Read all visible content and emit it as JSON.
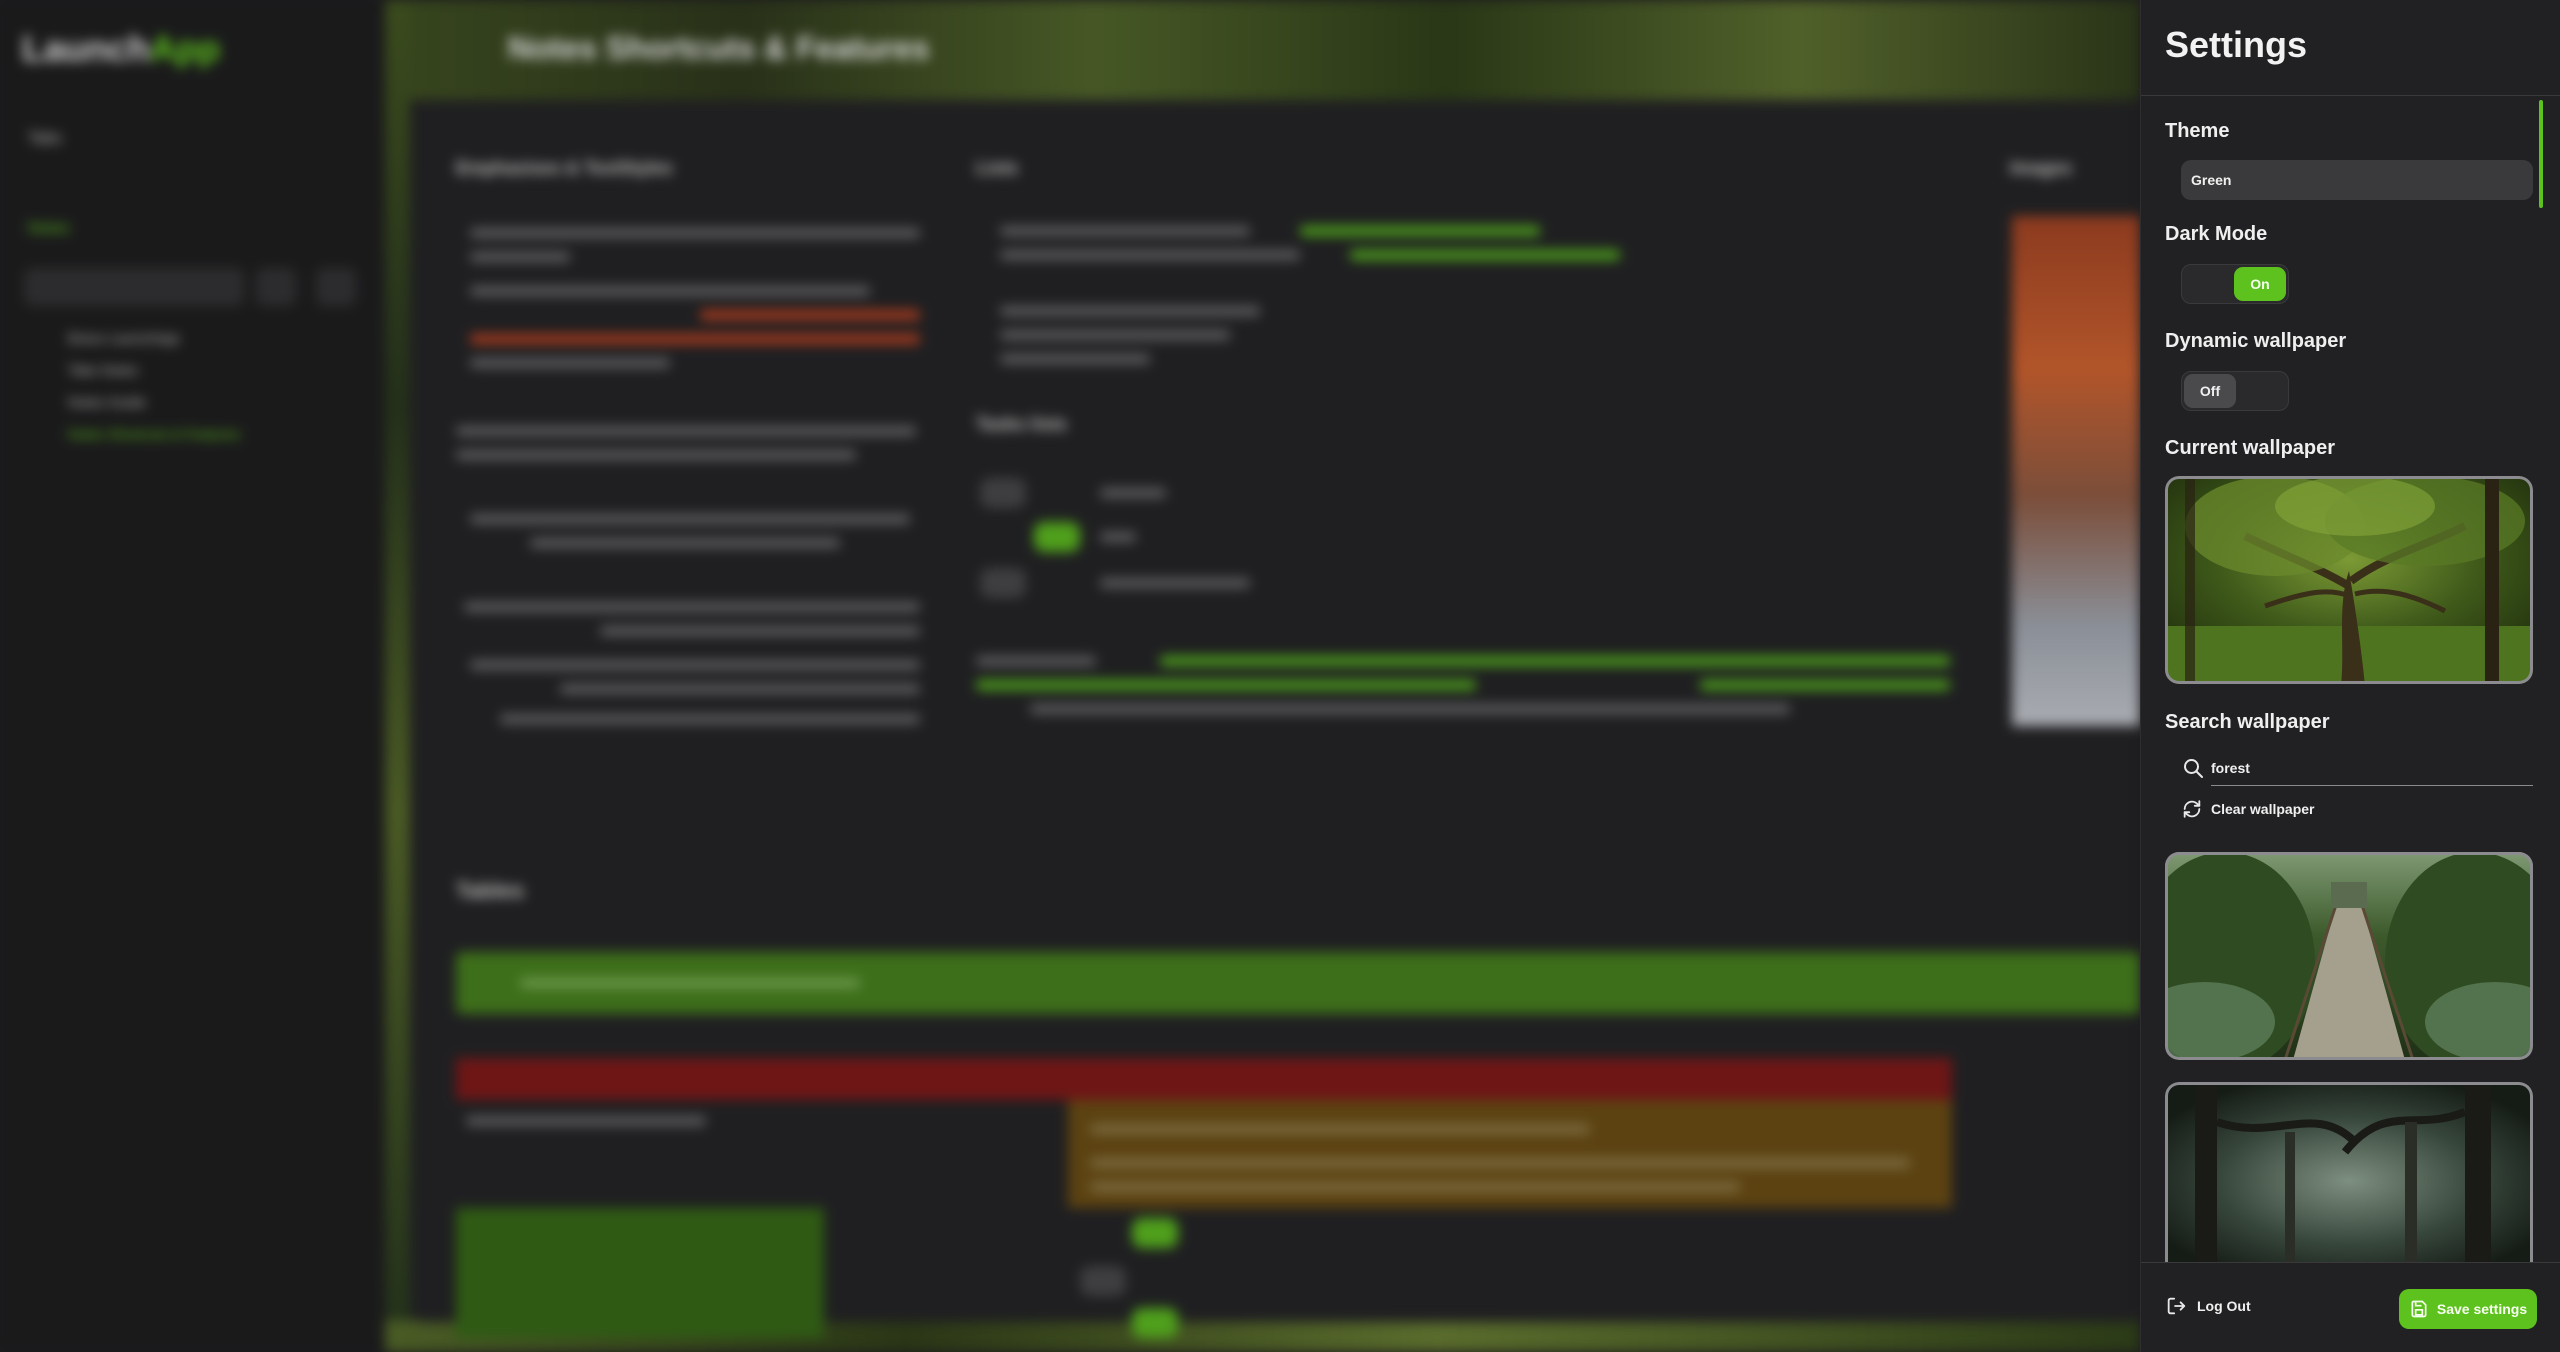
{
  "background_app": {
    "logo_text": "Launch",
    "logo_accent": "App",
    "sidebar": {
      "tabs_label": "Tabs",
      "notes_label": "Notes",
      "search_placeholder": "Launch Note",
      "notes": [
        "Bravo LaunchApp",
        "Take Notes",
        "Notes Guide",
        "Notes Shortcuts & Features"
      ]
    },
    "page_title": "Notes Shortcuts & Features",
    "sections": {
      "emphasis": "Emphasises & TextStyles",
      "lists": "Lists",
      "images": "Images",
      "tasks": "Tasks lists",
      "tables": "Tables"
    },
    "banner_text": "Tables have some of most possibilities as notes content"
  },
  "settings": {
    "title": "Settings",
    "theme": {
      "label": "Theme",
      "value": "Green"
    },
    "dark_mode": {
      "label": "Dark Mode",
      "state": "On"
    },
    "dynamic_wallpaper": {
      "label": "Dynamic wallpaper",
      "state": "Off"
    },
    "current_wallpaper": {
      "label": "Current wallpaper"
    },
    "search_wallpaper": {
      "label": "Search wallpaper",
      "query": "forest",
      "clear_label": "Clear wallpaper"
    },
    "footer": {
      "logout_label": "Log Out",
      "save_label": "Save settings"
    }
  },
  "colors": {
    "accent": "#5ec21e",
    "panel_bg": "#212123",
    "app_bg": "#1c1c1e"
  },
  "icons": {
    "search": "search-icon",
    "clear": "refresh-icon",
    "logout": "logout-icon",
    "save": "save-icon"
  }
}
